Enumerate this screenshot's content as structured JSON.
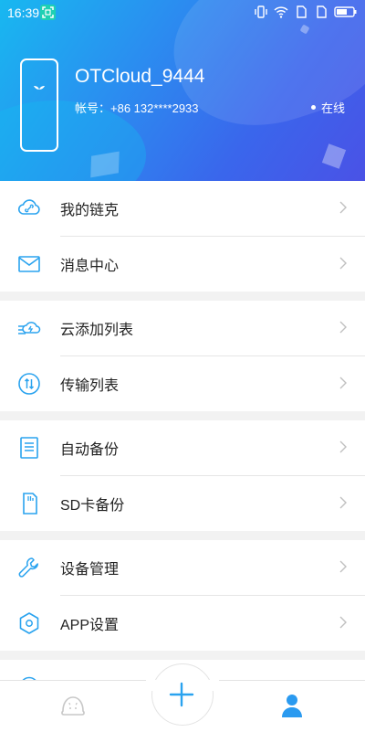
{
  "status": {
    "time": "16:39",
    "icons": [
      "screenshot-icon",
      "vibrate-icon",
      "wifi-icon",
      "sim1-icon",
      "sim2-icon",
      "battery-icon"
    ]
  },
  "header": {
    "device_name": "OTCloud_9444",
    "account": "帐号：+86 132****2933",
    "status": "在线"
  },
  "menu": {
    "groups": [
      [
        {
          "label": "我的链克",
          "icon": "cloud-link-icon"
        },
        {
          "label": "消息中心",
          "icon": "envelope-icon"
        }
      ],
      [
        {
          "label": "云添加列表",
          "icon": "cloud-add-icon"
        },
        {
          "label": "传输列表",
          "icon": "transfer-icon"
        }
      ],
      [
        {
          "label": "自动备份",
          "icon": "document-icon"
        },
        {
          "label": "SD卡备份",
          "icon": "sd-card-icon"
        }
      ],
      [
        {
          "label": "设备管理",
          "icon": "wrench-icon"
        },
        {
          "label": "APP设置",
          "icon": "settings-hexagon-icon"
        }
      ]
    ]
  },
  "bottom_nav": {
    "tabs": [
      {
        "name": "home",
        "icon": "mascot-icon"
      },
      {
        "name": "add",
        "icon": "plus-icon"
      },
      {
        "name": "me",
        "icon": "person-icon"
      }
    ]
  },
  "colors": {
    "accent": "#2aa3ef",
    "header_start": "#18b8f0",
    "header_end": "#4a52e6",
    "tab_active": "#2a9af0",
    "tab_inactive": "#c8c8c8"
  }
}
